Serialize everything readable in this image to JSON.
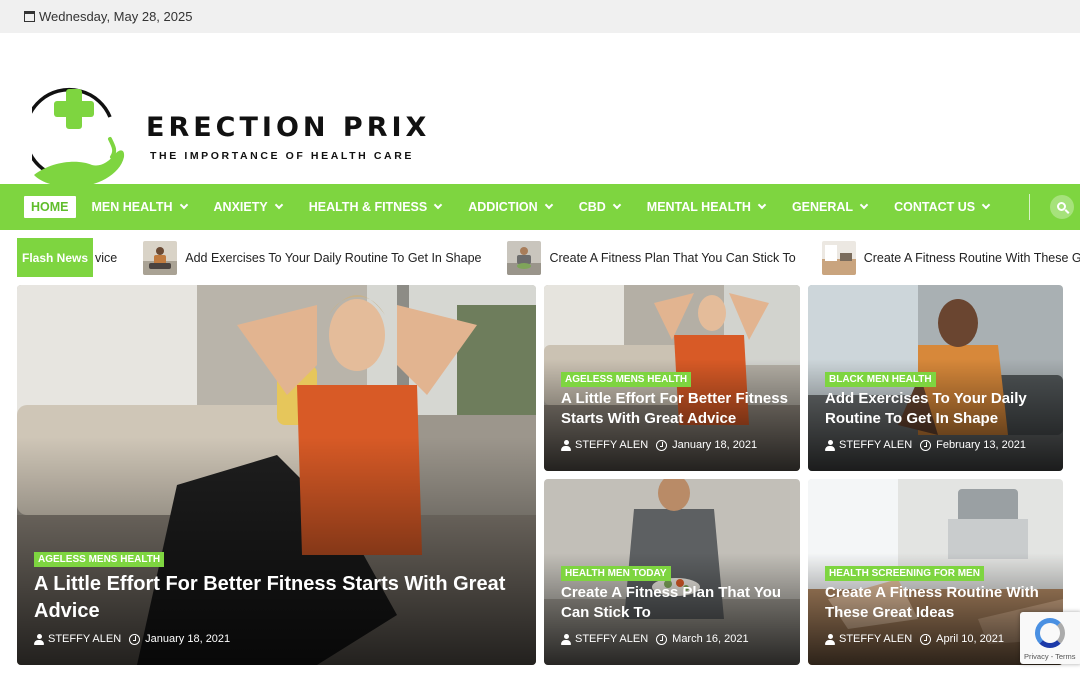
{
  "topbar": {
    "date": "Wednesday, May 28, 2025",
    "icon": "calendar-icon"
  },
  "brand": {
    "title": "ERECTION PRIX",
    "tagline": "THE IMPORTANCE OF HEALTH CARE",
    "colors": {
      "green": "#7ed540",
      "dark": "#111111"
    }
  },
  "nav": {
    "items": [
      {
        "label": "HOME",
        "active": true,
        "dropdown": false
      },
      {
        "label": "MEN HEALTH",
        "dropdown": true
      },
      {
        "label": "ANXIETY",
        "dropdown": true
      },
      {
        "label": "HEALTH & FITNESS",
        "dropdown": true
      },
      {
        "label": "ADDICTION",
        "dropdown": true
      },
      {
        "label": "CBD",
        "dropdown": true
      },
      {
        "label": "MENTAL HEALTH",
        "dropdown": true
      },
      {
        "label": "GENERAL",
        "dropdown": true
      },
      {
        "label": "CONTACT US",
        "dropdown": true
      }
    ],
    "search_icon": "search-icon",
    "accent": "#7ed540"
  },
  "ticker": {
    "label": "Flash News",
    "items": [
      {
        "title": "vice"
      },
      {
        "title": "Add Exercises To Your Daily Routine To Get In Shape"
      },
      {
        "title": "Create A Fitness Plan That You Can Stick To"
      },
      {
        "title": "Create A Fitness Routine With These Great Ideas"
      }
    ]
  },
  "posts": [
    {
      "category": "AGELESS MENS HEALTH",
      "title": "A Little Effort For Better Fitness Starts With Great Advice",
      "author": "STEFFY ALEN",
      "date": "January 18, 2021"
    },
    {
      "category": "AGELESS MENS HEALTH",
      "title": "A Little Effort For Better Fitness Starts With Great Advice",
      "author": "STEFFY ALEN",
      "date": "January 18, 2021"
    },
    {
      "category": "BLACK MEN HEALTH",
      "title": "Add Exercises To Your Daily Routine To Get In Shape",
      "author": "STEFFY ALEN",
      "date": "February 13, 2021"
    },
    {
      "category": "HEALTH MEN TODAY",
      "title": "Create A Fitness Plan That You Can Stick To",
      "author": "STEFFY ALEN",
      "date": "March 16, 2021"
    },
    {
      "category": "HEALTH SCREENING FOR MEN",
      "title": "Create A Fitness Routine With These Great Ideas",
      "author": "STEFFY ALEN",
      "date": "April 10, 2021"
    }
  ],
  "recaptcha": {
    "privacy": "Privacy",
    "separator": "-",
    "terms": "Terms"
  }
}
